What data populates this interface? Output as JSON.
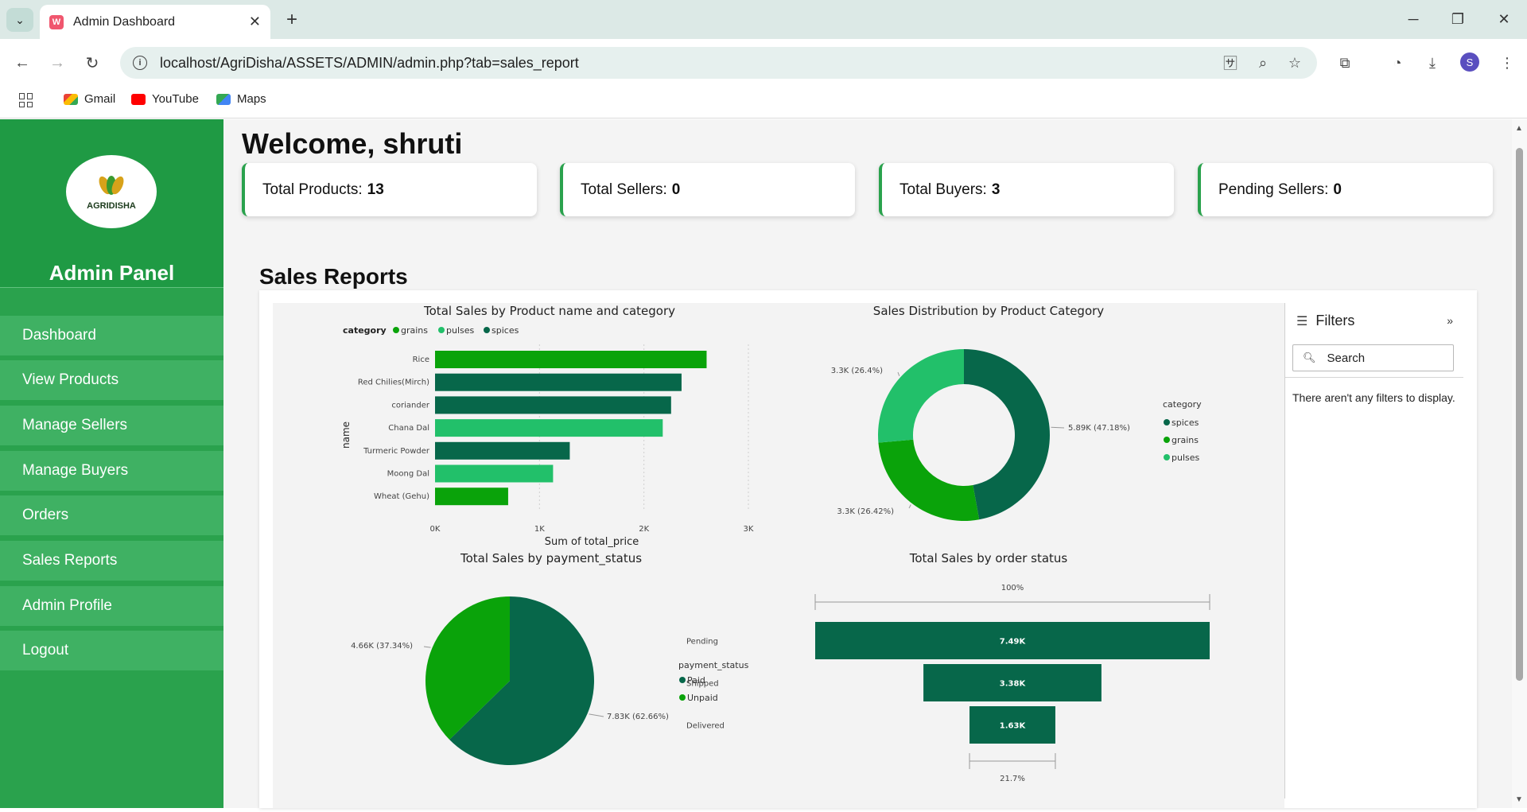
{
  "browser": {
    "tab_title": "Admin Dashboard",
    "url": "localhost/AgriDisha/ASSETS/ADMIN/admin.php?tab=sales_report",
    "profile_initial": "S",
    "bookmarks": [
      "Gmail",
      "YouTube",
      "Maps"
    ]
  },
  "sidebar": {
    "logo_text": "AGRIDISHA",
    "title": "Admin Panel",
    "items": [
      "Dashboard",
      "View Products",
      "Manage Sellers",
      "Manage Buyers",
      "Orders",
      "Sales Reports",
      "Admin Profile",
      "Logout"
    ]
  },
  "main": {
    "welcome": "Welcome, shruti",
    "cards": [
      {
        "label": "Total Products:",
        "value": "13"
      },
      {
        "label": "Total Sellers:",
        "value": "0"
      },
      {
        "label": "Total Buyers:",
        "value": "3"
      },
      {
        "label": "Pending Sellers:",
        "value": "0"
      }
    ],
    "section_title": "Sales Reports"
  },
  "filters": {
    "title": "Filters",
    "search_placeholder": "Search",
    "empty_message": "There aren't any filters to display."
  },
  "colors": {
    "grains": "#0aa30a",
    "pulses": "#22c06a",
    "spices": "#07674a",
    "sidebar": "#2aa24d"
  },
  "chart_data": [
    {
      "type": "bar",
      "title": "Total Sales by Product name and category",
      "xlabel": "Sum of total_price",
      "ylabel": "name",
      "legend_title": "category",
      "legend": [
        "grains",
        "pulses",
        "spices"
      ],
      "xlim": [
        0,
        3000
      ],
      "xticks": [
        "0K",
        "1K",
        "2K",
        "3K"
      ],
      "categories": [
        "Rice",
        "Red Chilies(Mirch)",
        "coriander",
        "Chana Dal",
        "Turmeric Powder",
        "Moong Dal",
        "Wheat (Gehu)"
      ],
      "values": [
        2600,
        2360,
        2260,
        2180,
        1290,
        1130,
        700
      ],
      "category_of": [
        "grains",
        "spices",
        "spices",
        "pulses",
        "spices",
        "pulses",
        "grains"
      ]
    },
    {
      "type": "pie",
      "title": "Sales Distribution by Product Category",
      "donut": true,
      "legend_title": "category",
      "legend": [
        "spices",
        "grains",
        "pulses"
      ],
      "slices": [
        {
          "name": "spices",
          "value": 5890,
          "label": "5.89K (47.18%)"
        },
        {
          "name": "grains",
          "value": 3300,
          "label": "3.3K (26.42%)"
        },
        {
          "name": "pulses",
          "value": 3300,
          "label": "3.3K (26.4%)"
        }
      ]
    },
    {
      "type": "pie",
      "title": "Total Sales by payment_status",
      "legend_title": "payment_status",
      "legend": [
        "Paid",
        "Unpaid"
      ],
      "slices": [
        {
          "name": "Paid",
          "value": 7830,
          "label": "7.83K (62.66%)"
        },
        {
          "name": "Unpaid",
          "value": 4660,
          "label": "4.66K (37.34%)"
        }
      ]
    },
    {
      "type": "bar",
      "subtype": "funnel",
      "title": "Total Sales by order status",
      "categories": [
        "Pending",
        "Shipped",
        "Delivered"
      ],
      "values": [
        7490,
        3380,
        1630
      ],
      "value_labels": [
        "7.49K",
        "3.38K",
        "1.63K"
      ],
      "top_label": "100%",
      "bottom_label": "21.7%"
    }
  ]
}
